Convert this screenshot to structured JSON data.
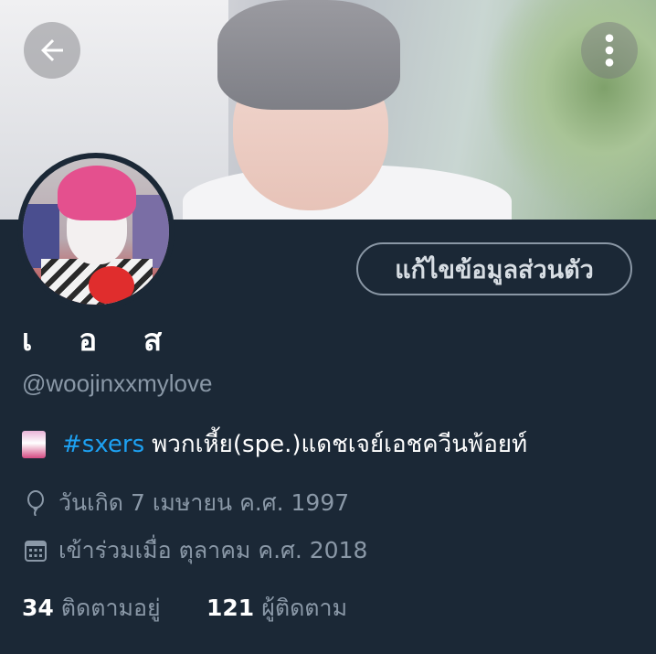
{
  "header": {
    "back_icon": "arrow-left-icon",
    "more_icon": "more-vertical-icon"
  },
  "profile": {
    "display_name": "เ    อ    ส",
    "handle": "@woojinxxmylove",
    "edit_button_label": "แก้ไขข้อมูลส่วนตัว",
    "bio": {
      "emoji": "joker-card-emoji",
      "hashtag": "#sxers",
      "text": "พวกเหี้ย(spe.)แดชเจย์เอชควีนพ้อยท์"
    },
    "birthday": "วันเกิด 7 เมษายน ค.ศ. 1997",
    "joined": "เข้าร่วมเมื่อ ตุลาคม ค.ศ. 2018",
    "following_count": "34",
    "following_label": "ติดตามอยู่",
    "followers_count": "121",
    "followers_label": "ผู้ติดตาม"
  },
  "colors": {
    "background": "#1b2836",
    "accent": "#1da1f2",
    "muted_text": "#8a98a7"
  }
}
